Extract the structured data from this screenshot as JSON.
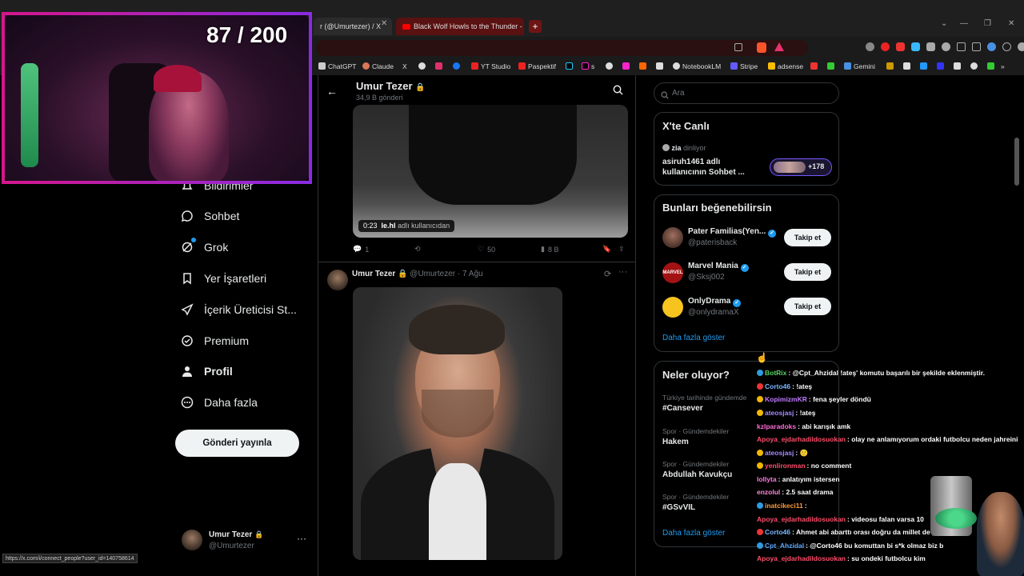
{
  "browser": {
    "tabs": [
      {
        "label": "r (@Umurtezer) / X"
      },
      {
        "label": "Black Wolf Howls to the Thunder - Yo"
      }
    ],
    "bookmarks": [
      "ChatGPT",
      "Claude",
      "X",
      "",
      "",
      "",
      "YT Studio",
      "Paspektif",
      "",
      "s",
      "",
      "",
      "",
      "",
      "NotebookLM",
      "Stripe",
      "adsense",
      "",
      "",
      "Gemini"
    ],
    "status_url": "https://x.com/i/connect_people?user_id=140758614"
  },
  "stream": {
    "counter": "87 / 200"
  },
  "nav": {
    "items": [
      {
        "label": "Bildirimler",
        "icon": "bell-icon"
      },
      {
        "label": "Sohbet",
        "icon": "chat-icon"
      },
      {
        "label": "Grok",
        "icon": "grok-icon"
      },
      {
        "label": "Yer İşaretleri",
        "icon": "bookmark-icon"
      },
      {
        "label": "İçerik Üreticisi St...",
        "icon": "rocket-icon"
      },
      {
        "label": "Premium",
        "icon": "premium-icon"
      },
      {
        "label": "Profil",
        "icon": "person-icon"
      },
      {
        "label": "Daha fazla",
        "icon": "more-icon"
      }
    ],
    "post_button": "Gönderi yayınla",
    "account": {
      "name": "Umur Tezer",
      "handle": "@Umurtezer",
      "more": "···"
    }
  },
  "profile_header": {
    "name": "Umur Tezer",
    "count": "34,9 B gönderi"
  },
  "post1": {
    "video_time": "0:23",
    "video_source": "le.hl",
    "video_source_suffix": "adlı kullanıcıdan",
    "replies": "1",
    "likes": "50",
    "views": "8 B"
  },
  "post2": {
    "name": "Umur Tezer",
    "handle": "@Umurtezer",
    "date": "· 7 Ağu"
  },
  "right": {
    "search_placeholder": "Ara",
    "live": {
      "title": "X'te Canlı",
      "host": "zia",
      "host_suffix": "dinliyor",
      "line1": "asiruh1461 adlı",
      "line2": "kullanıcının Sohbet ...",
      "listeners": "+178"
    },
    "suggestions": {
      "title": "Bunları beğenebilirsin",
      "follow_label": "Takip et",
      "items": [
        {
          "name": "Pater Familias(Yen...",
          "handle": "@paterisback"
        },
        {
          "name": "Marvel Mania",
          "handle": "@Sksj002"
        },
        {
          "name": "OnlyDrama",
          "handle": "@onlydramaX"
        }
      ],
      "more": "Daha fazla göster"
    },
    "trends": {
      "title": "Neler oluyor?",
      "items": [
        {
          "context": "Türkiye tarihinde gündemde",
          "name": "#Cansever"
        },
        {
          "context": "Spor · Gündemdekiler",
          "name": "Hakem"
        },
        {
          "context": "Spor · Gündemdekiler",
          "name": "Abdullah Kavukçu"
        },
        {
          "context": "Spor · Gündemdekiler",
          "name": "#GSvVIL"
        }
      ],
      "more": "Daha fazla göster"
    }
  },
  "chat": [
    {
      "user": "BotRix",
      "text": ": @Cpt_Ahzidal !ateş' komutu başarılı bir şekilde eklenmiştir.",
      "color": "#56d364"
    },
    {
      "user": "Corto46",
      "text": ": !ateş",
      "color": "#7ab8ff"
    },
    {
      "user": "KopimizmKR",
      "text": ": fena şeyler döndü",
      "color": "#c07bff"
    },
    {
      "user": "ateosjasj",
      "text": ": !ateş",
      "color": "#a58bff"
    },
    {
      "user": "kzlparadoks",
      "text": ": abi karışık amk",
      "color": "#ff6bd5"
    },
    {
      "user": "Apoya_ejdarhadildosuokan",
      "text": ": olay ne anlamıyorum ordaki futbolcu neden jahreini",
      "color": "#ff4d6a"
    },
    {
      "user": "ateosjasj",
      "text": ": 🙂",
      "color": "#a58bff"
    },
    {
      "user": "yenlironman",
      "text": ": no comment",
      "color": "#ff4d6a"
    },
    {
      "user": "lollyta",
      "text": ": anlatıyım istersen",
      "color": "#ff7ae0"
    },
    {
      "user": "enzolul",
      "text": ": 2.5 saat drama",
      "color": "#ff8ad8"
    },
    {
      "user": "inatcikeci11",
      "text": ":",
      "color": "#ff9a3d"
    },
    {
      "user": "Apoya_ejdarhadildosuokan",
      "text": ": videosu falan varsa 10",
      "color": "#ff4d6a"
    },
    {
      "user": "Corto46",
      "text": ": Ahmet abi abarttı orası doğru da millet de y",
      "color": "#7ab8ff"
    },
    {
      "user": "Cpt_Ahzidal",
      "text": ": @Corto46 bu komuttan bi s*k olmaz biz b",
      "color": "#59a8ff"
    },
    {
      "user": "Apoya_ejdarhadildosuokan",
      "text": ": su ondeki futbolcu kim",
      "color": "#ff4d6a"
    }
  ]
}
